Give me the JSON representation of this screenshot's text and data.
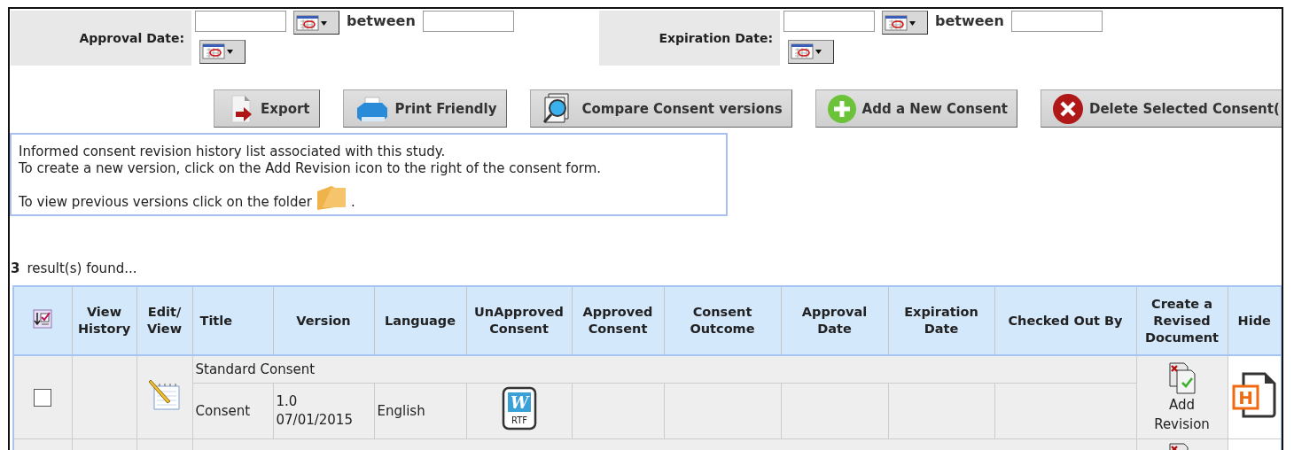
{
  "filters": [
    {
      "label": "Approval Date:",
      "between": "between"
    },
    {
      "label": "Expiration Date:",
      "between": "between"
    }
  ],
  "buttons": [
    {
      "label": "Export",
      "kind": "export"
    },
    {
      "label": "Print Friendly",
      "kind": "print"
    },
    {
      "label": "Compare Consent versions",
      "kind": "compare"
    },
    {
      "label": "Add a New Consent",
      "kind": "add"
    },
    {
      "label": "Delete Selected Consent(",
      "kind": "delete"
    }
  ],
  "info": {
    "lines": [
      "Informed consent revision history list associated with this study.",
      "To create a new version, click on the Add Revision icon to the right of the consent form."
    ],
    "folder_line": "To view previous versions click on the folder",
    "folder_end": "."
  },
  "results": {
    "count": "3",
    "text": "result(s) found..."
  },
  "table": {
    "columns": [
      "View History",
      "Edit/ View",
      "Title",
      "Version",
      "Language",
      "UnApproved Consent",
      "Approved Consent",
      "Consent Outcome",
      "Approval Date",
      "Expiration Date",
      "Checked Out By",
      "Create a Revised Document",
      "Hide"
    ],
    "rows": [
      {
        "kind": "full",
        "group": "Standard Consent",
        "checked": false,
        "title": "Consent",
        "version": "1.0",
        "date": "07/01/2015",
        "language": "English",
        "doc_letter": "W",
        "doc_format": "RTF",
        "add_revision": "Add Revision",
        "hide_letter": "H"
      },
      {
        "kind": "partial"
      }
    ]
  }
}
